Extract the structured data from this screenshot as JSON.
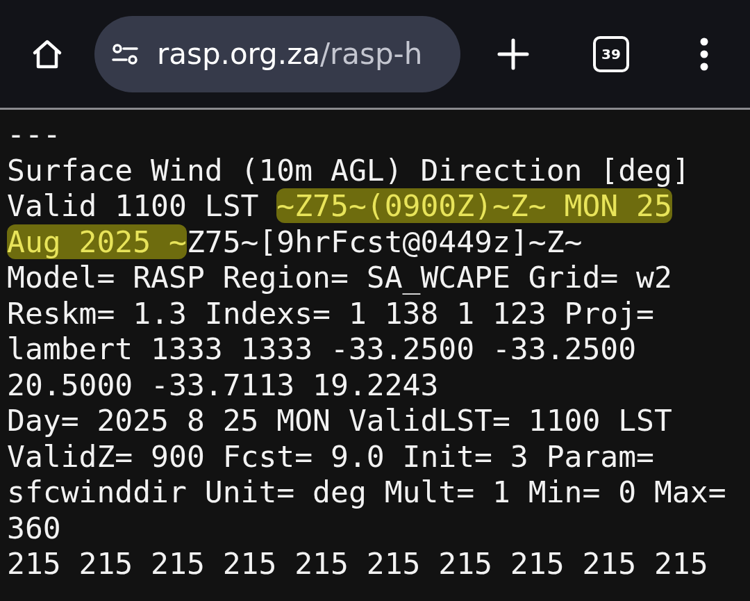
{
  "toolbar": {
    "url_host": "rasp.org.za",
    "url_path": "/rasp-h",
    "tab_count": "39"
  },
  "lines": [
    [
      {
        "text": "---",
        "highlighted": false
      }
    ],
    [
      {
        "text": "Surface Wind (10m AGL) Direction [deg]",
        "highlighted": false
      }
    ],
    [
      {
        "text": "Valid 1100 LST ",
        "highlighted": false
      },
      {
        "text": "~Z75~(0900Z)~Z~ MON 25",
        "highlighted": true
      }
    ],
    [
      {
        "text": "Aug 2025 ~",
        "highlighted": true
      },
      {
        "text": "Z75~[9hrFcst@0449z]~Z~",
        "highlighted": false
      }
    ],
    [
      {
        "text": "Model= RASP Region= SA_WCAPE Grid= w2",
        "highlighted": false
      }
    ],
    [
      {
        "text": "Reskm= 1.3 Indexs= 1 138 1 123 Proj=",
        "highlighted": false
      }
    ],
    [
      {
        "text": "lambert 1333 1333 -33.2500 -33.2500",
        "highlighted": false
      }
    ],
    [
      {
        "text": "20.5000 -33.7113 19.2243",
        "highlighted": false
      }
    ],
    [
      {
        "text": "Day= 2025 8 25 MON ValidLST= 1100 LST",
        "highlighted": false
      }
    ],
    [
      {
        "text": "ValidZ= 900 Fcst= 9.0 Init= 3 Param=",
        "highlighted": false
      }
    ],
    [
      {
        "text": "sfcwinddir Unit= deg Mult= 1 Min= 0 Max=",
        "highlighted": false
      }
    ],
    [
      {
        "text": "360",
        "highlighted": false
      }
    ],
    [
      {
        "text": "215 215 215 215 215 215 215 215 215 215",
        "highlighted": false
      }
    ]
  ]
}
